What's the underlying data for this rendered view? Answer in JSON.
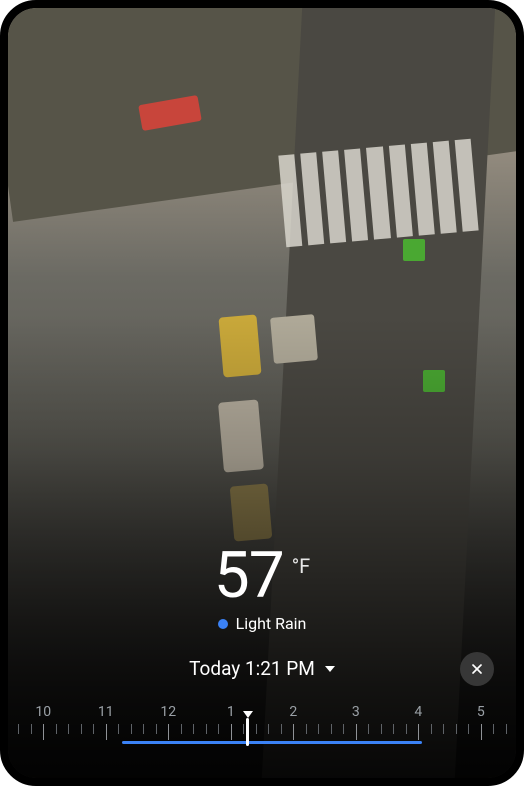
{
  "weather": {
    "temperature": "57",
    "unit": "°F",
    "condition": "Light Rain",
    "condition_color": "#3b82f6"
  },
  "datetime": {
    "label": "Today 1:21 PM"
  },
  "close": {
    "label": "Close"
  },
  "timeline": {
    "hours": [
      "10",
      "11",
      "12",
      "1",
      "2",
      "3",
      "4",
      "5"
    ],
    "range_start_pct": 22,
    "range_end_pct": 82,
    "playhead_pct": 47
  },
  "colors": {
    "accent": "#3b82f6"
  }
}
